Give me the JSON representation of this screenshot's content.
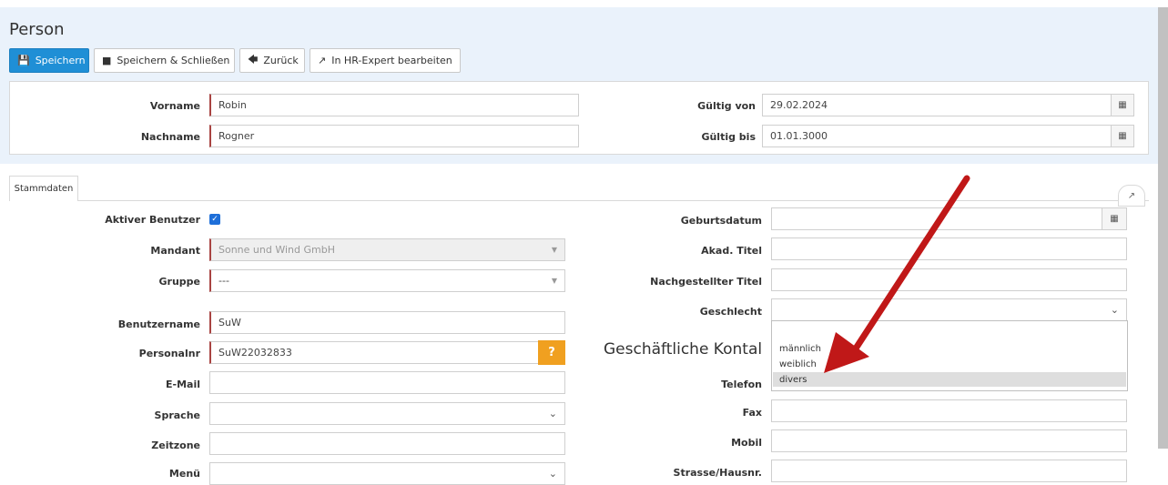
{
  "page": {
    "title": "Person"
  },
  "toolbar": {
    "save": "Speichern",
    "save_close": "Speichern & Schließen",
    "back": "Zurück",
    "hr_expert": "In HR-Expert bearbeiten"
  },
  "header": {
    "firstname_label": "Vorname",
    "firstname_value": "Robin",
    "lastname_label": "Nachname",
    "lastname_value": "Rogner",
    "valid_from_label": "Gültig von",
    "valid_from_value": "29.02.2024",
    "valid_to_label": "Gültig bis",
    "valid_to_value": "01.01.3000"
  },
  "tabs": {
    "stammdaten": "Stammdaten"
  },
  "form_left": {
    "active_user_label": "Aktiver Benutzer",
    "active_user_checked": true,
    "client_label": "Mandant",
    "client_value": "Sonne und Wind GmbH",
    "group_label": "Gruppe",
    "group_value": "---",
    "username_label": "Benutzername",
    "username_value": "SuW",
    "personnel_no_label": "Personalnr",
    "personnel_no_value": "SuW22032833",
    "personnel_help": "?",
    "email_label": "E-Mail",
    "email_value": "",
    "language_label": "Sprache",
    "timezone_label": "Zeitzone",
    "menu_label": "Menü"
  },
  "form_right": {
    "birthdate_label": "Geburtsdatum",
    "acad_title_label": "Akad. Titel",
    "suffix_title_label": "Nachgestellter Titel",
    "gender_label": "Geschlecht",
    "gender_options": [
      "männlich",
      "weiblich",
      "divers"
    ],
    "gender_highlighted": "divers",
    "business_contact_heading": "Geschäftliche Kontal",
    "phone_label": "Telefon",
    "fax_label": "Fax",
    "mobile_label": "Mobil",
    "street_label": "Strasse/Hausnr."
  },
  "colors": {
    "primary": "#1f8fd6",
    "required_border": "#a94442",
    "help_button": "#f0a020",
    "annotation_arrow": "#c01818"
  }
}
